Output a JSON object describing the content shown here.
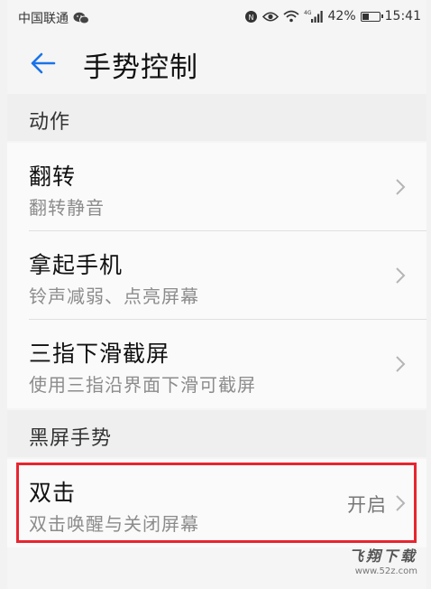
{
  "status_bar": {
    "carrier": "中国联通",
    "network": "4G",
    "battery_percent": "42%",
    "battery_level": 0.42,
    "time": "15:41"
  },
  "header": {
    "title": "手势控制",
    "back_icon": "arrow-left-icon"
  },
  "sections": [
    {
      "header": "动作",
      "items": [
        {
          "title": "翻转",
          "subtitle": "翻转静音"
        },
        {
          "title": "拿起手机",
          "subtitle": "铃声减弱、点亮屏幕"
        },
        {
          "title": "三指下滑截屏",
          "subtitle": "使用三指沿界面下滑可截屏"
        }
      ]
    },
    {
      "header": "黑屏手势",
      "items": [
        {
          "title": "双击",
          "subtitle": "双击唤醒与关闭屏幕",
          "value": "开启"
        }
      ]
    }
  ],
  "watermark": {
    "title": "飞翔下载",
    "url": "www.52z.com"
  },
  "colors": {
    "accent": "#1a73e8",
    "highlight": "#e8252f",
    "background": "#f5f5f5"
  }
}
